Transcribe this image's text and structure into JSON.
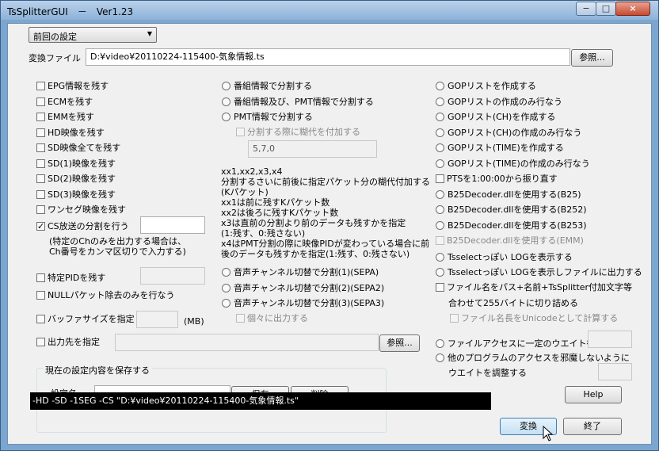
{
  "window": {
    "title": "TsSplitterGUI　－　Ver1.23",
    "minimize": "−",
    "maximize": "□",
    "close": "×"
  },
  "preset": {
    "selected": "前回の設定"
  },
  "file": {
    "label": "変換ファイル",
    "value": "D:¥video¥20110224-115400-気象情報.ts",
    "browse": "参照..."
  },
  "col1": {
    "epg": "EPG情報を残す",
    "ecm": "ECMを残す",
    "emm": "EMMを残す",
    "hd": "HD映像を残す",
    "sd_all": "SD映像全てを残す",
    "sd1": "SD(1)映像を残す",
    "sd2": "SD(2)映像を残す",
    "sd3": "SD(3)映像を残す",
    "oneseg": "ワンセグ映像を残す",
    "cs_split": "CS放送の分割を行う",
    "cs_note": "(特定のChのみを出力する場合は、\nCh番号をカンマ区切りで入力する)",
    "pid": "特定PIDを残す",
    "null": "NULLパケット除去のみを行なう",
    "buffer": "バッファサイズを指定",
    "buffer_unit": "(MB)",
    "outdir": "出力先を指定",
    "outdir_browse": "参照..."
  },
  "col2": {
    "r1": "番組情報で分割する",
    "r2": "番組情報及び、PMT情報で分割する",
    "r3": "PMT情報で分割する",
    "margin_chk": "分割する際に糊代を付加する",
    "margin_value": "5,7,0",
    "help": "xx1,xx2,x3,x4\n分割するさいに前後に指定パケット分の糊代付加する\n(Kパケット)\nxx1は前に残すKパケット数\nxx2は後ろに残すKパケット数\nx3は直前の分割より前のデータも残すかを指定\n(1:残す、0:残さない)\nx4はPMT分割の際に映像PIDが変わっている場合に前\n後のデータも残すかを指定(1:残す、0:残さない)",
    "sepa1": "音声チャンネル切替で分割(1)(SEPA)",
    "sepa2": "音声チャンネル切替で分割(2)(SEPA2)",
    "sepa3": "音声チャンネル切替で分割(3)(SEPA3)",
    "separate_out": "個々に出力する"
  },
  "col3": {
    "gop1": "GOPリストを作成する",
    "gop2": "GOPリストの作成のみ行なう",
    "gop3": "GOPリスト(CH)を作成する",
    "gop4": "GOPリスト(CH)の作成のみ行なう",
    "gop5": "GOPリスト(TIME)を作成する",
    "gop6": "GOPリスト(TIME)の作成のみ行なう",
    "pts": "PTSを1:00:00から振り直す",
    "b25": "B25Decoder.dllを使用する(B25)",
    "b252": "B25Decoder.dllを使用する(B252)",
    "b253": "B25Decoder.dllを使用する(B253)",
    "emm": "B25Decoder.dllを使用する(EMM)",
    "log1": "Tsselectっぽい LOGを表示する",
    "log2": "Tsselectっぽい LOGを表示しファイルに出力する",
    "filename": "ファイル名をパス+名前+TsSplitter付加文字等",
    "filename2": "合わせて255バイトに切り詰める",
    "unicode": "ファイル名長をUnicodeとして計算する",
    "wait1": "ファイルアクセスに一定のウエイト行なう",
    "wait2a": "他のプログラムのアクセスを邪魔しないように",
    "wait2b": "ウエイトを調整する",
    "help": "Help"
  },
  "save": {
    "group": "現在の設定内容を保存する",
    "name_label": "設定名",
    "save": "保存",
    "delete": "削除"
  },
  "cmdline": "-HD -SD -1SEG -CS \"D:¥video¥20110224-115400-気象情報.ts\"",
  "actions": {
    "convert": "変換",
    "exit": "終了"
  }
}
